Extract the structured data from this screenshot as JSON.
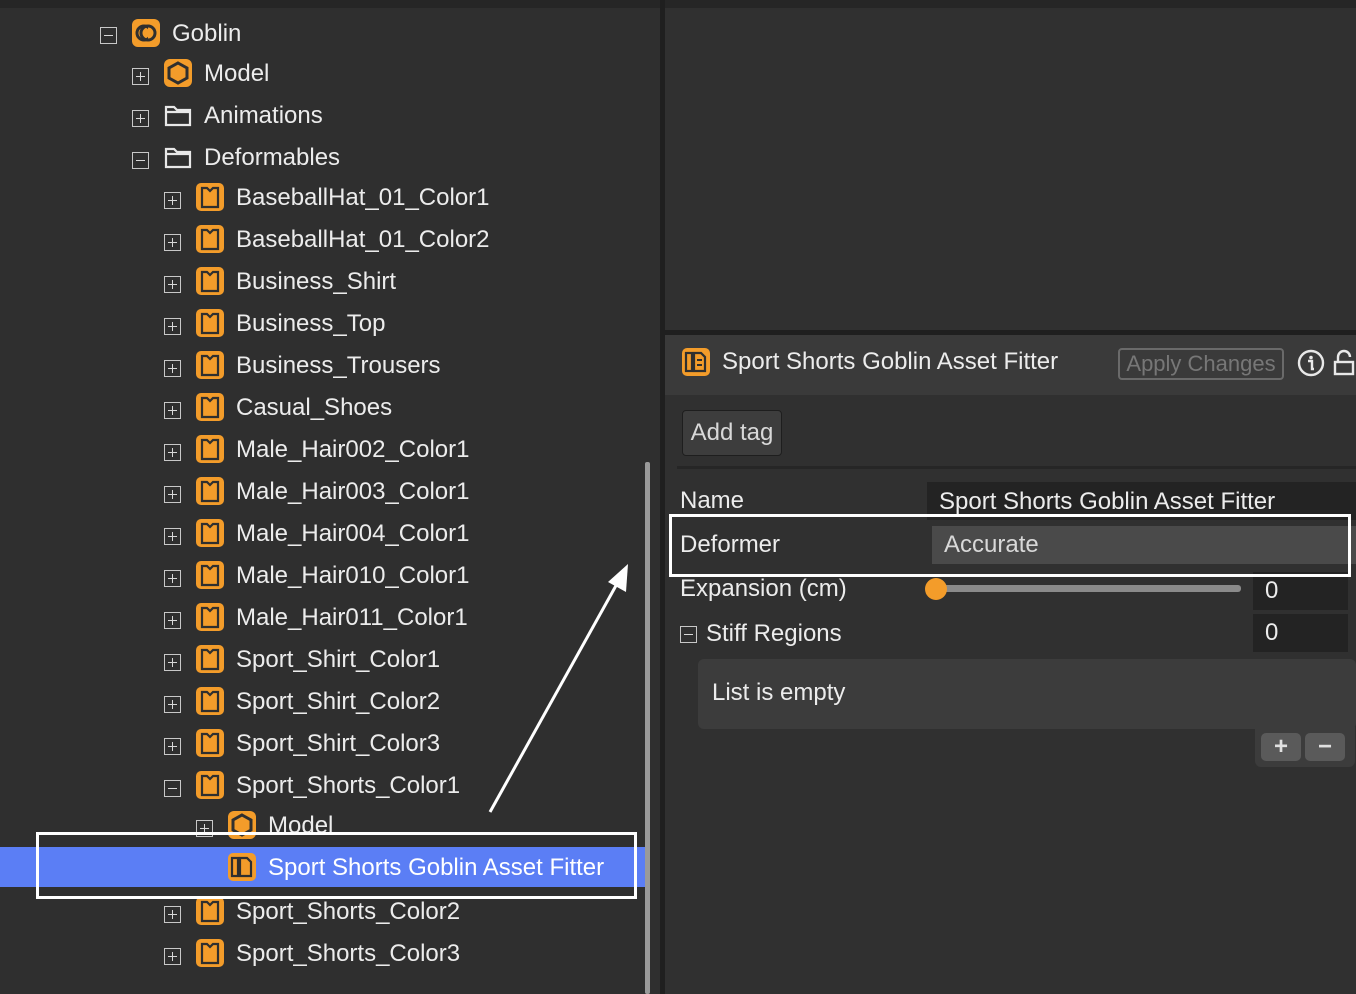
{
  "tree": {
    "items": [
      {
        "label": "Goblin",
        "toggle": "minus",
        "icon": "character-icon"
      },
      {
        "label": "Model",
        "toggle": "plus",
        "icon": "hexagon-model-icon"
      },
      {
        "label": "Animations",
        "toggle": "plus",
        "icon": "folder-icon"
      },
      {
        "label": "Deformables",
        "toggle": "minus",
        "icon": "folder-icon"
      },
      {
        "label": "BaseballHat_01_Color1",
        "toggle": "plus",
        "icon": "garment-icon"
      },
      {
        "label": "BaseballHat_01_Color2",
        "toggle": "plus",
        "icon": "garment-icon"
      },
      {
        "label": "Business_Shirt",
        "toggle": "plus",
        "icon": "garment-icon"
      },
      {
        "label": "Business_Top",
        "toggle": "plus",
        "icon": "garment-icon"
      },
      {
        "label": "Business_Trousers",
        "toggle": "plus",
        "icon": "garment-icon"
      },
      {
        "label": "Casual_Shoes",
        "toggle": "plus",
        "icon": "garment-icon"
      },
      {
        "label": "Male_Hair002_Color1",
        "toggle": "plus",
        "icon": "garment-icon"
      },
      {
        "label": "Male_Hair003_Color1",
        "toggle": "plus",
        "icon": "garment-icon"
      },
      {
        "label": "Male_Hair004_Color1",
        "toggle": "plus",
        "icon": "garment-icon"
      },
      {
        "label": "Male_Hair010_Color1",
        "toggle": "plus",
        "icon": "garment-icon"
      },
      {
        "label": "Male_Hair011_Color1",
        "toggle": "plus",
        "icon": "garment-icon"
      },
      {
        "label": "Sport_Shirt_Color1",
        "toggle": "plus",
        "icon": "garment-icon"
      },
      {
        "label": "Sport_Shirt_Color2",
        "toggle": "plus",
        "icon": "garment-icon"
      },
      {
        "label": "Sport_Shirt_Color3",
        "toggle": "plus",
        "icon": "garment-icon"
      },
      {
        "label": "Sport_Shorts_Color1",
        "toggle": "minus",
        "icon": "garment-icon"
      },
      {
        "label": "Model",
        "toggle": "plus",
        "icon": "hexagon-model-icon"
      },
      {
        "label": "Sport Shorts Goblin Asset Fitter",
        "toggle": "none",
        "icon": "asset-fitter-icon",
        "selected": true
      },
      {
        "label": "Sport_Shorts_Color2",
        "toggle": "plus",
        "icon": "garment-icon"
      },
      {
        "label": "Sport_Shorts_Color3",
        "toggle": "plus",
        "icon": "garment-icon"
      }
    ]
  },
  "inspector": {
    "title": "Sport Shorts Goblin Asset Fitter",
    "apply_label": "Apply Changes",
    "add_tag_label": "Add tag",
    "name_label": "Name",
    "name_value": "Sport Shorts Goblin Asset Fitter",
    "deformer_label": "Deformer",
    "deformer_value": "Accurate",
    "expansion_label": "Expansion (cm)",
    "expansion_value": "0",
    "stiff_label": "Stiff Regions",
    "stiff_value": "0",
    "list_empty": "List is empty",
    "add_label": "+",
    "remove_label": "−"
  },
  "colors": {
    "accent_orange": "#f39c2a",
    "selection_blue": "#5b7ef5",
    "panel_bg": "#2f2f2f"
  }
}
